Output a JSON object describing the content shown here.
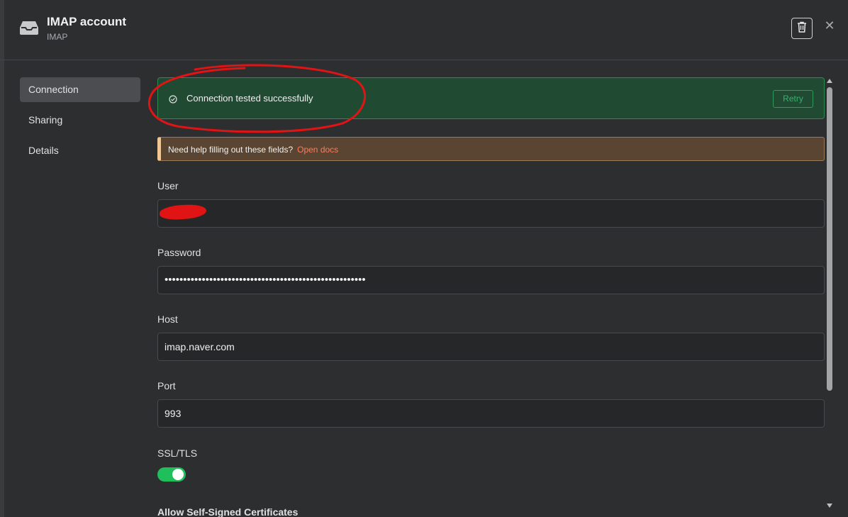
{
  "header": {
    "title": "IMAP account",
    "subtitle": "IMAP",
    "app_icon": "inbox-tray-icon",
    "delete_icon": "trash-icon",
    "close_icon": "close-icon",
    "close_glyph": "✕"
  },
  "sidebar": {
    "items": [
      {
        "label": "Connection",
        "active": true
      },
      {
        "label": "Sharing",
        "active": false
      },
      {
        "label": "Details",
        "active": false
      }
    ]
  },
  "status": {
    "message": "Connection tested successfully",
    "retry_label": "Retry",
    "icon": "check-circle-icon"
  },
  "help": {
    "text": "Need help filling out these fields?",
    "link_text": "Open docs"
  },
  "form": {
    "user": {
      "label": "User",
      "value": ""
    },
    "password": {
      "label": "Password",
      "value": "••••••••••••••••••••••••••••••••••••••••••••••••••••••"
    },
    "host": {
      "label": "Host",
      "value": "imap.naver.com"
    },
    "port": {
      "label": "Port",
      "value": "993"
    },
    "ssl": {
      "label": "SSL/TLS",
      "enabled": true
    },
    "next_label": "Allow Self-Signed Certificates"
  },
  "colors": {
    "success_bg": "#214a33",
    "success_border": "#2f8a52",
    "retry": "#34b36b",
    "help_bg": "#5a4532",
    "help_accent": "#f0c896",
    "link": "#ff7a5c",
    "toggle_on": "#1fbf5c",
    "annotation": "#e01414"
  }
}
